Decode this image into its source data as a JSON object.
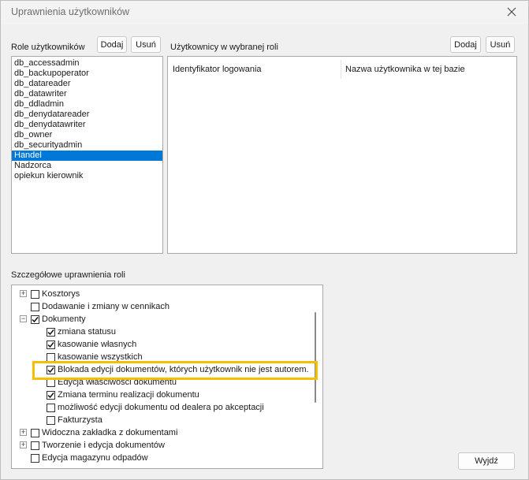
{
  "window": {
    "title": "Uprawnienia użytkowników"
  },
  "roles": {
    "label": "Role użytkowników",
    "add_label": "Dodaj",
    "remove_label": "Usuń",
    "items": [
      {
        "label": "db_accessadmin",
        "selected": false
      },
      {
        "label": "db_backupoperator",
        "selected": false
      },
      {
        "label": "db_datareader",
        "selected": false
      },
      {
        "label": "db_datawriter",
        "selected": false
      },
      {
        "label": "db_ddladmin",
        "selected": false
      },
      {
        "label": "db_denydatareader",
        "selected": false
      },
      {
        "label": "db_denydatawriter",
        "selected": false
      },
      {
        "label": "db_owner",
        "selected": false
      },
      {
        "label": "db_securityadmin",
        "selected": false
      },
      {
        "label": "Handel",
        "selected": true
      },
      {
        "label": "Nadzorca",
        "selected": false
      },
      {
        "label": "opiekun kierownik",
        "selected": false
      }
    ]
  },
  "users": {
    "label": "Użytkownicy w wybranej roli",
    "add_label": "Dodaj",
    "remove_label": "Usuń",
    "columns": [
      "Identyfikator logowania",
      "Nazwa użytkownika w tej bazie"
    ]
  },
  "permissions": {
    "label": "Szczegółowe uprawnienia roli",
    "items": [
      {
        "label": "Kosztorys",
        "level": 0,
        "expander": "+",
        "checked": false
      },
      {
        "label": "Dodawanie i zmiany w cennikach",
        "level": 0,
        "expander": "",
        "checked": false
      },
      {
        "label": "Dokumenty",
        "level": 0,
        "expander": "−",
        "checked": true
      },
      {
        "label": "zmiana statusu",
        "level": 1,
        "expander": "",
        "checked": true
      },
      {
        "label": "kasowanie własnych",
        "level": 1,
        "expander": "",
        "checked": true
      },
      {
        "label": "kasowanie wszystkich",
        "level": 1,
        "expander": "",
        "checked": false
      },
      {
        "label": "Blokada edycji dokumentów, których użytkownik nie jest autorem.",
        "level": 1,
        "expander": "",
        "checked": true
      },
      {
        "label": "Edycja właściwości dokumentu",
        "level": 1,
        "expander": "",
        "checked": false
      },
      {
        "label": "Zmiana terminu realizacji dokumentu",
        "level": 1,
        "expander": "",
        "checked": true
      },
      {
        "label": "możliwość edycji dokumentu od dealera po akceptacji",
        "level": 1,
        "expander": "",
        "checked": false
      },
      {
        "label": "Fakturzysta",
        "level": 1,
        "expander": "",
        "checked": false
      },
      {
        "label": "Widoczna zakładka z dokumentami",
        "level": 0,
        "expander": "+",
        "checked": false
      },
      {
        "label": "Tworzenie i edycja dokumentów",
        "level": 0,
        "expander": "+",
        "checked": false
      },
      {
        "label": "Edycja magazynu odpadów",
        "level": 0,
        "expander": "",
        "checked": false
      }
    ]
  },
  "footer": {
    "close_label": "Wyjdź"
  },
  "colors": {
    "selection": "#0078d7",
    "highlight": "#f5c000"
  }
}
